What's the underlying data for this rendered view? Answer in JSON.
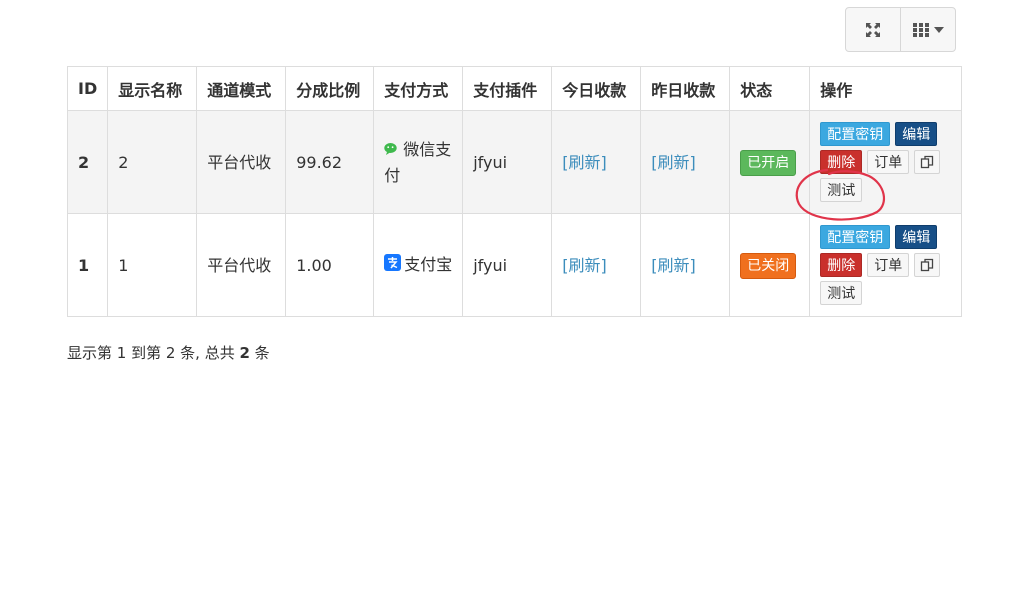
{
  "toolbar": {
    "fullscreen_icon": "fullscreen-icon",
    "columns_icon": "grid-columns-icon"
  },
  "table": {
    "headers": [
      "ID",
      "显示名称",
      "通道模式",
      "分成比例",
      "支付方式",
      "支付插件",
      "今日收款",
      "昨日收款",
      "状态",
      "操作"
    ],
    "rows": [
      {
        "id": "2",
        "name": "2",
        "mode": "平台代收",
        "ratio": "99.62",
        "pay_icon": "wechat-icon",
        "pay_method": "微信支付",
        "plugin": "jfyui",
        "today": "[刷新]",
        "yesterday": "[刷新]",
        "status": "已开启",
        "status_color": "#5cb85c",
        "ops": {
          "config": "配置密钥",
          "edit": "编辑",
          "delete": "删除",
          "orders": "订单",
          "test": "测试"
        }
      },
      {
        "id": "1",
        "name": "1",
        "mode": "平台代收",
        "ratio": "1.00",
        "pay_icon": "alipay-icon",
        "pay_method": "支付宝",
        "plugin": "jfyui",
        "today": "[刷新]",
        "yesterday": "[刷新]",
        "status": "已关闭",
        "status_color": "#f0701e",
        "ops": {
          "config": "配置密钥",
          "edit": "编辑",
          "delete": "删除",
          "orders": "订单",
          "test": "测试"
        }
      }
    ]
  },
  "footer": {
    "prefix": "显示第 1 到第 2 条, 总共 ",
    "total": "2",
    "suffix": " 条"
  },
  "colors": {
    "link": "#3c8dbc",
    "config_btn": "#3ba8e0",
    "edit_btn": "#174f87",
    "delete_btn": "#c9302c",
    "annotation": "#e0344a"
  }
}
